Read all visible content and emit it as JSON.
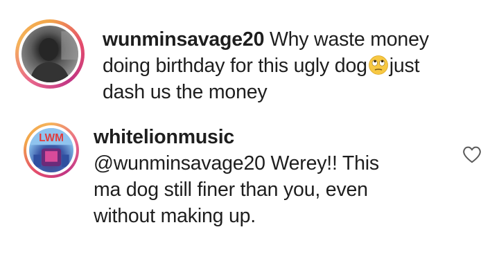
{
  "comments": [
    {
      "username": "wunminsavage20",
      "text_line1": "Why waste money",
      "text_line2a": "doing birthday for this ugly dog",
      "emoji": "face-with-rolling-eyes-emoji",
      "text_line2b": "just",
      "text_line3": "dash us the money"
    },
    {
      "username": "whitelionmusic",
      "mention": "@wunminsavage20",
      "text_line1": "Werey!! This",
      "text_line2": "ma dog still finer than you, even",
      "text_line3": "without making up.",
      "like_icon": "heart-icon",
      "avatar_text": "LWM"
    }
  ]
}
